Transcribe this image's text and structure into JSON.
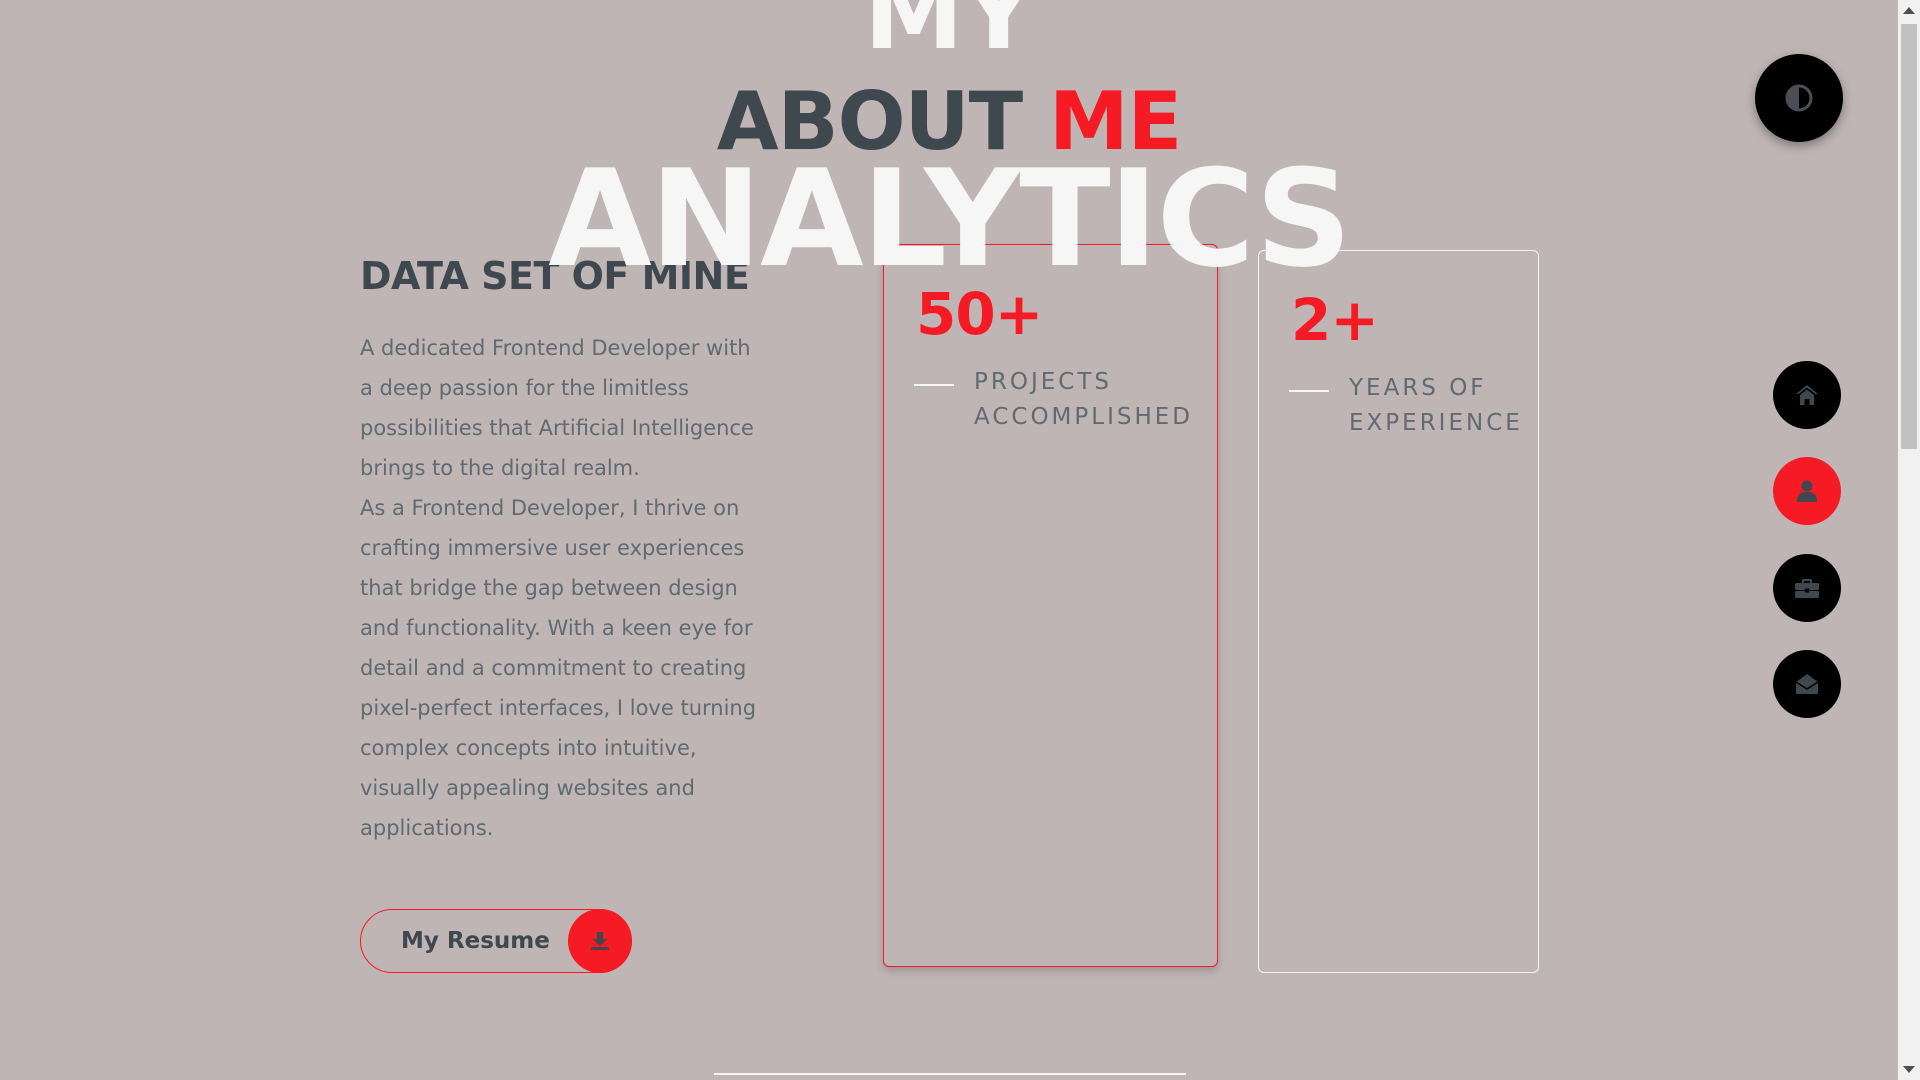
{
  "header": {
    "bg_top_word": "MY",
    "heading_main": "ABOUT",
    "heading_accent": "ME",
    "bg_bottom_word": "ANALYTICS"
  },
  "about": {
    "title": "DATA SET OF MINE",
    "paragraphs": [
      "A dedicated Frontend Developer with a deep passion for the limitless possibilities that Artificial Intelligence brings to the digital realm.",
      "As a Frontend Developer, I thrive on crafting immersive user experiences that bridge the gap between design and functionality. With a keen eye for detail and a commitment to creating pixel-perfect interfaces, I love turning complex concepts into intuitive, visually appealing websites and applications."
    ],
    "resume_button": {
      "label": "My Resume",
      "icon": "download-icon"
    }
  },
  "stats": [
    {
      "value": "50+",
      "label": "PROJECTS ACCOMPLISHED"
    },
    {
      "value": "2+",
      "label": "YEARS OF EXPERIENCE"
    }
  ],
  "side_nav": {
    "theme_toggle_icon": "half-circle-contrast-icon",
    "items": [
      {
        "icon": "home-icon",
        "active": false
      },
      {
        "icon": "user-icon",
        "active": true
      },
      {
        "icon": "briefcase-icon",
        "active": false
      },
      {
        "icon": "envelope-open-icon",
        "active": false
      }
    ]
  },
  "colors": {
    "background": "#bfb5b4",
    "accent": "#f51a24",
    "heading": "#3f474f",
    "text": "#5f6a72",
    "ghost_text": "#f6f6f6",
    "nav_button": "#000000"
  }
}
